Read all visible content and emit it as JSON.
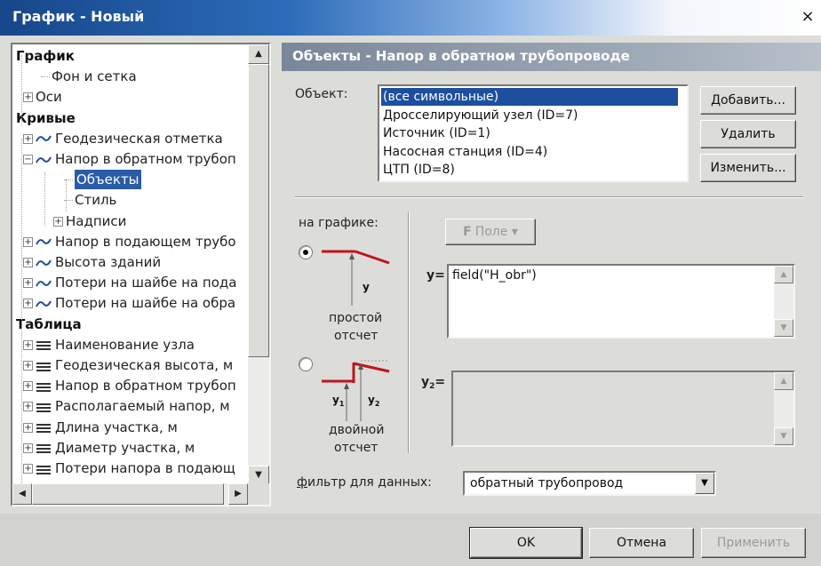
{
  "window": {
    "title": "График - Новый",
    "close_glyph": "×"
  },
  "tree": {
    "rows": [
      {
        "label": "График",
        "kind": "header"
      },
      {
        "label": "Фон и сетка",
        "kind": "leaf"
      },
      {
        "label": "Оси",
        "kind": "expandable",
        "expander": "+"
      },
      {
        "label": "Кривые",
        "kind": "header"
      },
      {
        "label": "Геодезическая отметка",
        "kind": "curve",
        "expander": "+"
      },
      {
        "label": "Напор в обратном трубоп",
        "kind": "curve",
        "expander": "−"
      },
      {
        "label": "Объекты",
        "kind": "leaf",
        "selected": true
      },
      {
        "label": "Стиль",
        "kind": "leaf"
      },
      {
        "label": "Надписи",
        "kind": "expandable",
        "expander": "+"
      },
      {
        "label": "Напор в подающем трубо",
        "kind": "curve",
        "expander": "+"
      },
      {
        "label": "Высота зданий",
        "kind": "curve",
        "expander": "+"
      },
      {
        "label": "Потери на шайбе на пода",
        "kind": "curve",
        "expander": "+"
      },
      {
        "label": "Потери на шайбе на обра",
        "kind": "curve",
        "expander": "+"
      },
      {
        "label": "Таблица",
        "kind": "header"
      },
      {
        "label": "Наименование узла",
        "kind": "column",
        "expander": "+"
      },
      {
        "label": "Геодезическая высота, м",
        "kind": "column",
        "expander": "+"
      },
      {
        "label": "Напор в обратном трубоп",
        "kind": "column",
        "expander": "+"
      },
      {
        "label": "Располагаемый напор, м",
        "kind": "column",
        "expander": "+"
      },
      {
        "label": "Длина участка, м",
        "kind": "column",
        "expander": "+"
      },
      {
        "label": "Диаметр участка, м",
        "kind": "column",
        "expander": "+"
      },
      {
        "label": "Потери напора в подающ",
        "kind": "column",
        "expander": "+"
      }
    ],
    "scroll_up": "▲",
    "scroll_down": "▼",
    "scroll_left": "◀",
    "scroll_right": "▶",
    "icons": {
      "curve": "wave-icon",
      "column": "lines-icon"
    }
  },
  "section": {
    "title": "Объекты - Напор в обратном трубопроводе"
  },
  "object_field": {
    "label": "Объект:",
    "items": [
      {
        "label": "(все символьные)",
        "selected": true
      },
      {
        "label": "Дросселирующий узел (ID=7)"
      },
      {
        "label": "Источник (ID=1)"
      },
      {
        "label": "Насосная станция (ID=4)"
      },
      {
        "label": "ЦТП (ID=8)"
      }
    ]
  },
  "buttons": {
    "add": "Добавить...",
    "delete": "Удалить",
    "edit": "Изменить..."
  },
  "on_chart": {
    "label": "на графике:",
    "simple_caption_1": "простой",
    "simple_caption_2": "отсчет",
    "double_caption_1": "двойной",
    "double_caption_2": "отсчет",
    "mode": "simple",
    "y_letter": "y",
    "y1_letter": "y",
    "y1_sub": "1",
    "y2_letter": "y",
    "y2_sub": "2",
    "red_color": "#c0141c"
  },
  "field_button": {
    "letter": "F",
    "label": "Поле",
    "arrow": "▾"
  },
  "y_field": {
    "label": "y=",
    "value": "field(\"H_obr\")"
  },
  "y2_field": {
    "label": "y",
    "sub": "2",
    "eq": "=",
    "value": ""
  },
  "filter": {
    "label": "фильтр для данных:",
    "value": "обратный трубопровод",
    "arrow": "▼"
  },
  "dialog_buttons": {
    "ok": "OK",
    "cancel": "Отмена",
    "apply": "Применить"
  }
}
